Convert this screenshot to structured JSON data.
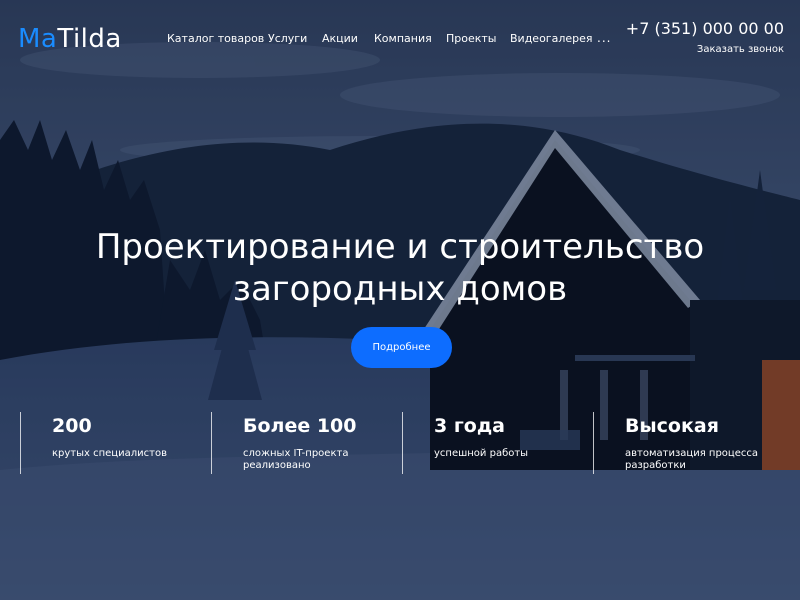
{
  "header": {
    "logo_accent": "Ma",
    "logo_rest": "Tilda",
    "nav": [
      {
        "label": "Каталог товаров"
      },
      {
        "label": "Услуги"
      },
      {
        "label": "Акции"
      },
      {
        "label": "Компания"
      },
      {
        "label": "Проекты"
      },
      {
        "label": "Видеогалерея"
      }
    ],
    "nav_more": "...",
    "phone": "+7 (351) 000 00 00",
    "callback": "Заказать звонок"
  },
  "hero": {
    "title_line1": "Проектирование и строительство",
    "title_line2": "загородных домов",
    "cta_label": "Подробнее"
  },
  "stats": [
    {
      "value": "200",
      "label": "крутых специалистов"
    },
    {
      "value": "Более 100",
      "label": "сложных IT-проекта реализовано"
    },
    {
      "value": "3 года",
      "label": "успешной работы"
    },
    {
      "value": "Высокая",
      "label": "автоматизация процесса разработки"
    }
  ],
  "colors": {
    "accent": "#1a8cff",
    "button": "#0d6dff",
    "overlay": "#0a1630"
  }
}
